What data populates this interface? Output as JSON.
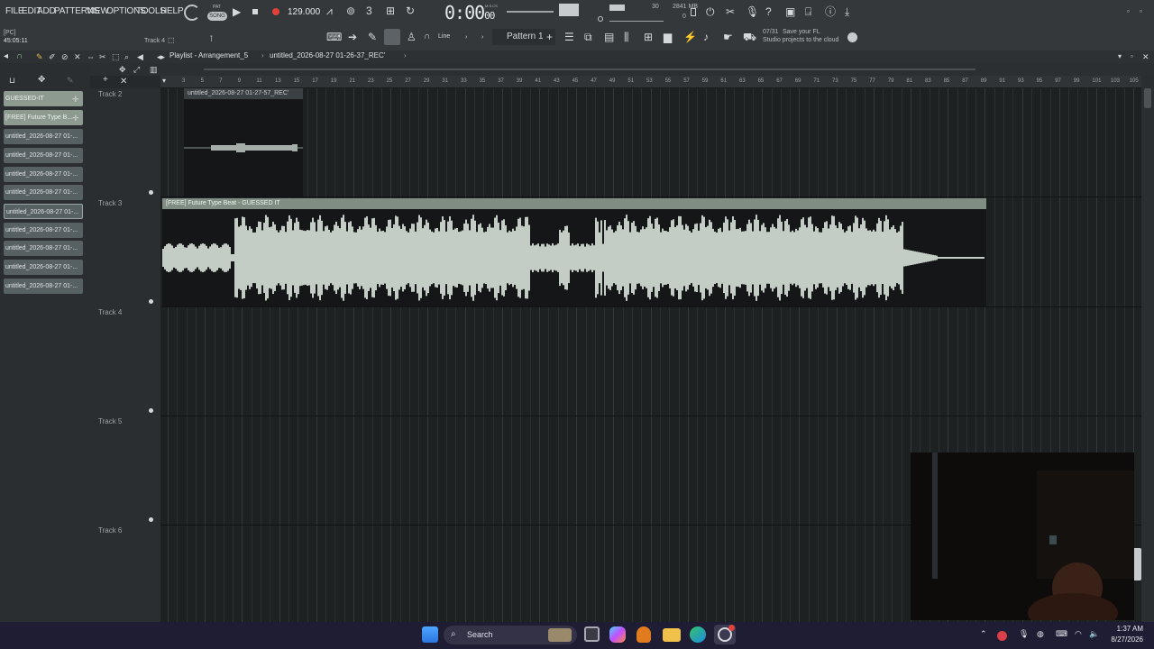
{
  "menu": [
    "FILE",
    "EDIT",
    "ADD",
    "PATTERNS",
    "VIEW",
    "OPTIONS",
    "TOOLS",
    "HELP"
  ],
  "transport": {
    "mode": "SONG",
    "mode_alt": "PAT",
    "tempo": "129.000",
    "time_main": "0:00",
    "time_ms": "00",
    "time_unit": "M:S:CS"
  },
  "status": {
    "channel_hint": "[PC]",
    "position": "45:05:11",
    "track_hint": "Track 4",
    "memory": "2841 MB",
    "cpu_count": "30",
    "poly": "0"
  },
  "toolbar2": {
    "snap": "Line",
    "pattern": "Pattern 1"
  },
  "promo": {
    "date": "07/31",
    "line1": "Save your FL",
    "line2": "Studio projects to the cloud"
  },
  "playlist": {
    "title": "Playlist - Arrangement_5",
    "crumb": "untitled_2026-08-27 01-26-37_REC'"
  },
  "patterns": [
    "GUESSED-IT",
    "[FREE] Future Type B...",
    "untitled_2026-08-27 01-...",
    "untitled_2026-08-27 01-...",
    "untitled_2026-08-27 01-...",
    "untitled_2026-08-27 01-...",
    "untitled_2026-08-27 01-...",
    "untitled_2026-08-27 01-...",
    "untitled_2026-08-27 01-...",
    "untitled_2026-08-27 01-...",
    "untitled_2026-08-27 01-..."
  ],
  "ruler_ticks": [
    "3",
    "5",
    "7",
    "9",
    "11",
    "13",
    "15",
    "17",
    "19",
    "21",
    "23",
    "25",
    "27",
    "29",
    "31",
    "33",
    "35",
    "37",
    "39",
    "41",
    "43",
    "45",
    "47",
    "49",
    "51",
    "53",
    "55",
    "57",
    "59",
    "61",
    "63",
    "65",
    "67",
    "69",
    "71",
    "73",
    "75",
    "77",
    "79",
    "81",
    "83",
    "85",
    "87",
    "89",
    "91",
    "93",
    "95",
    "97",
    "99",
    "101",
    "103",
    "105"
  ],
  "tracks": [
    "Track 2",
    "Track 3",
    "Track 4",
    "Track 5",
    "Track 6"
  ],
  "clips": {
    "rec": "untitled_2026-08-27 01-27-57_REC'",
    "beat": "[FREE] Future Type Beat - GUESSED IT"
  },
  "taskbar": {
    "search": "Search",
    "time": "1:37 AM",
    "date": "8/27/2026"
  },
  "colors": {
    "clip_header": "#7f8d82",
    "waveform": "#c3ccc5",
    "taskbar": "#1f1d33",
    "record": "#e0413b"
  }
}
